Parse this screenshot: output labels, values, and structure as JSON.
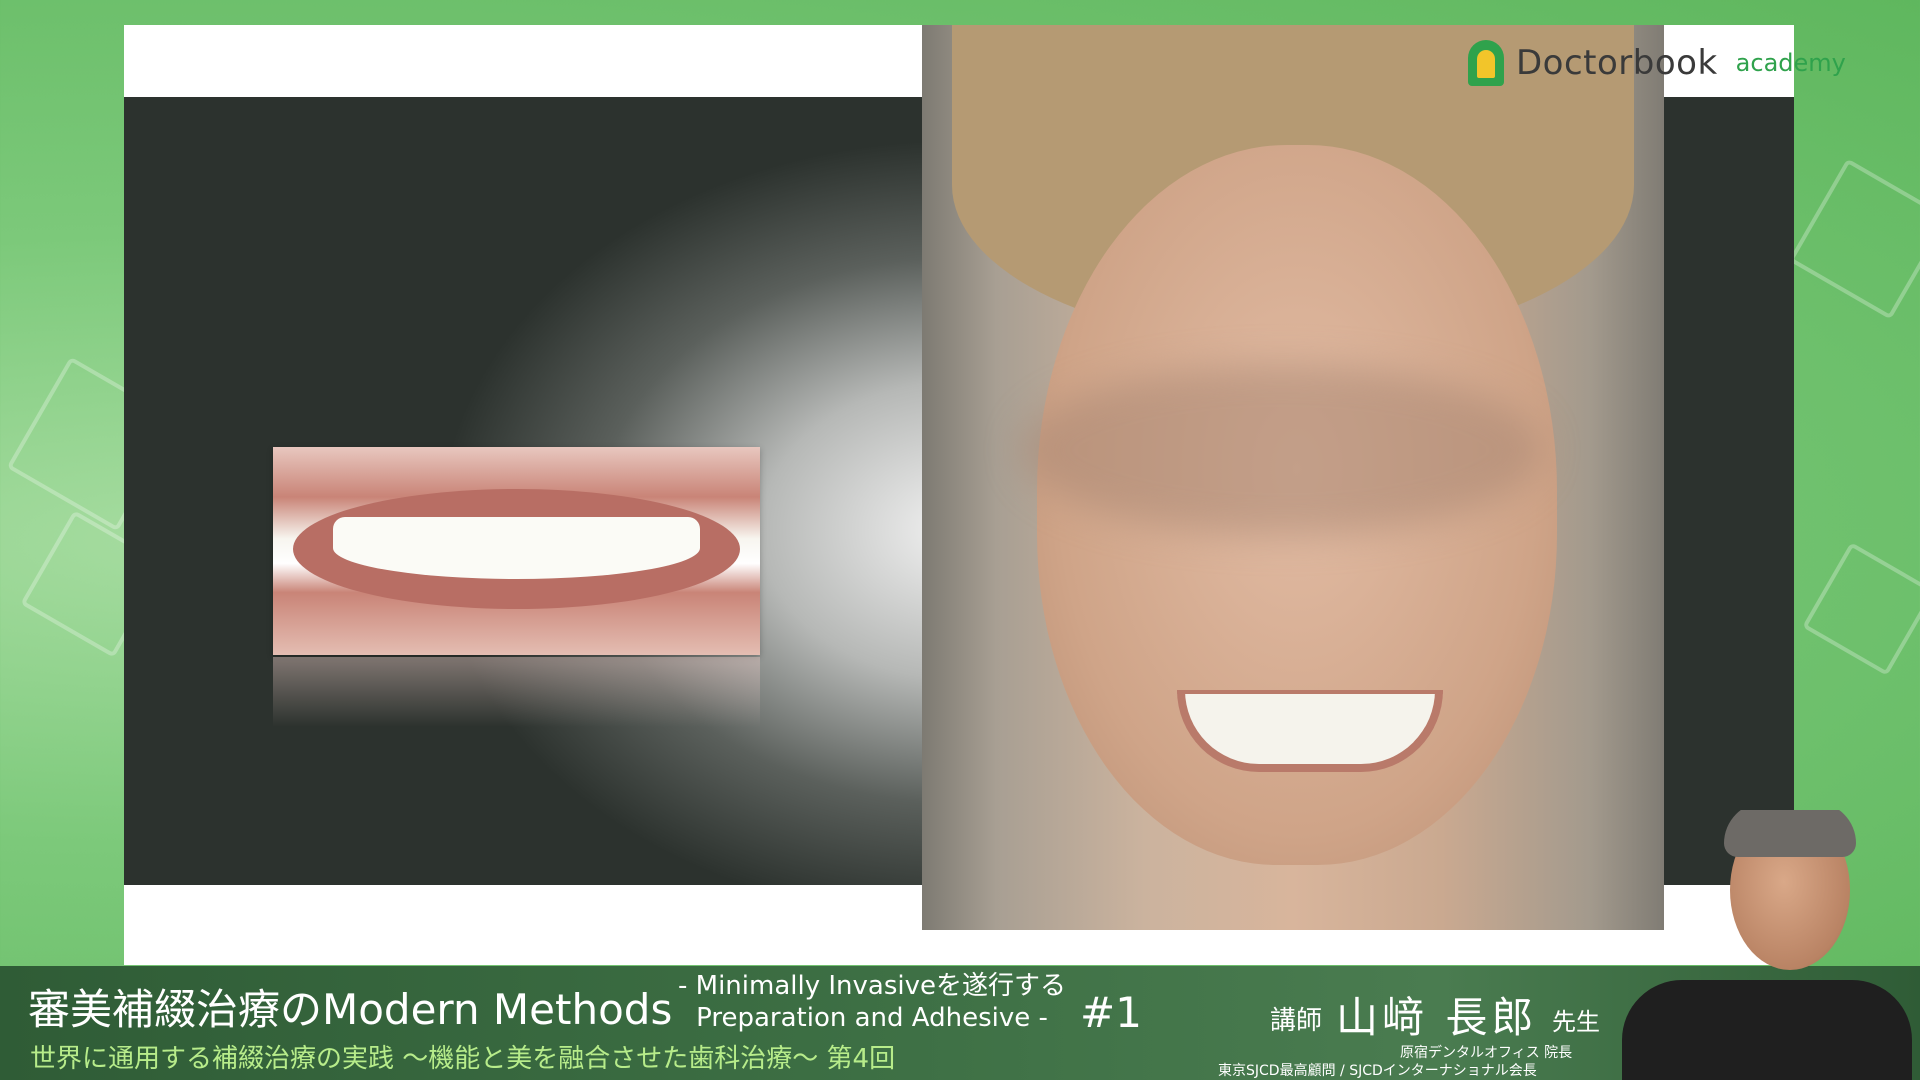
{
  "logo": {
    "name": "Doctorbook",
    "sub": "academy"
  },
  "course": {
    "title": "審美補綴治療のModern Methods",
    "subtitle_line1": "- Minimally Invasiveを遂行する",
    "subtitle_line2": "Preparation and Adhesive -",
    "episode": "#1",
    "series": "世界に通用する補綴治療の実践 〜機能と美を融合させた歯科治療〜 第4回"
  },
  "lecturer": {
    "label": "講師",
    "name": "山﨑 長郎",
    "honorific": "先生",
    "title1": "原宿デンタルオフィス 院長",
    "title2": "東京SJCD最高顧問 / SJCDインターナショナル会長"
  },
  "colors": {
    "bar": "#3d6f44",
    "series_text": "#b7ec8a",
    "logo_green": "#2fa24c"
  }
}
